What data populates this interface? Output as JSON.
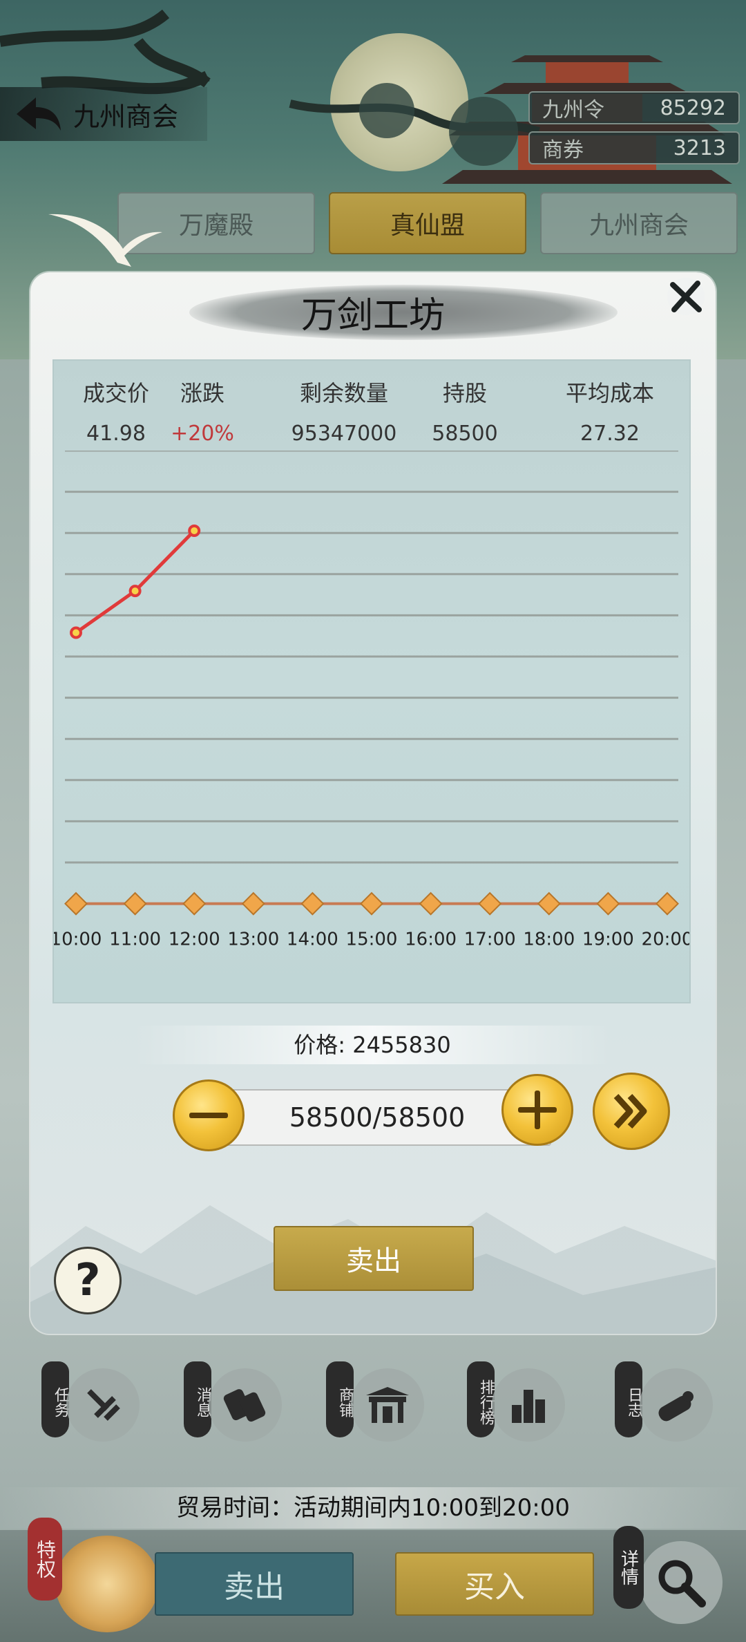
{
  "header": {
    "back_title": "九州商会",
    "currencies": [
      {
        "name": "九州令",
        "value": "85292"
      },
      {
        "name": "商券",
        "value": "3213"
      }
    ]
  },
  "tabs": [
    {
      "label": "万魔殿",
      "active": false
    },
    {
      "label": "真仙盟",
      "active": true
    },
    {
      "label": "九州商会",
      "active": false
    }
  ],
  "modal": {
    "title": "万剑工坊",
    "stats_headers": [
      "成交价",
      "涨跌",
      "剩余数量",
      "持股",
      "平均成本"
    ],
    "stats_values": [
      "41.98",
      "+20%",
      "95347000",
      "58500",
      "27.32"
    ],
    "price_label": "价格: 2455830",
    "quantity": "58500/58500",
    "sell_label": "卖出",
    "help_icon": "?"
  },
  "chart_data": {
    "type": "line",
    "x": [
      "10:00",
      "11:00",
      "12:00",
      "13:00",
      "14:00",
      "15:00",
      "16:00",
      "17:00",
      "18:00",
      "19:00",
      "20:00"
    ],
    "series": [
      {
        "values": [
          30.5,
          35.2,
          41.98
        ],
        "color": "#e03a3a"
      }
    ],
    "title": "",
    "xlabel": "",
    "ylabel": "",
    "ylim": [
      0,
      51
    ],
    "grid": true,
    "gridline_count": 11,
    "axis_marker_color": "#f0a64a",
    "axis_line_color": "#c87a52"
  },
  "nav": [
    {
      "label": "任务",
      "icon": "task-icon"
    },
    {
      "label": "消息",
      "icon": "message-icon"
    },
    {
      "label": "商铺",
      "icon": "shop-icon"
    },
    {
      "label": "排行榜",
      "icon": "ranking-icon"
    },
    {
      "label": "日志",
      "icon": "log-icon"
    }
  ],
  "trade_time": "贸易时间：活动期间内10:00到20:00",
  "bottom": {
    "privilege_label": "特权",
    "sell_label": "卖出",
    "buy_label": "买入",
    "detail_label": "详情"
  },
  "colors": {
    "accent_gold": "#c7aa4c",
    "teal_button": "#3d6a73",
    "rise_red": "#c0393b"
  }
}
